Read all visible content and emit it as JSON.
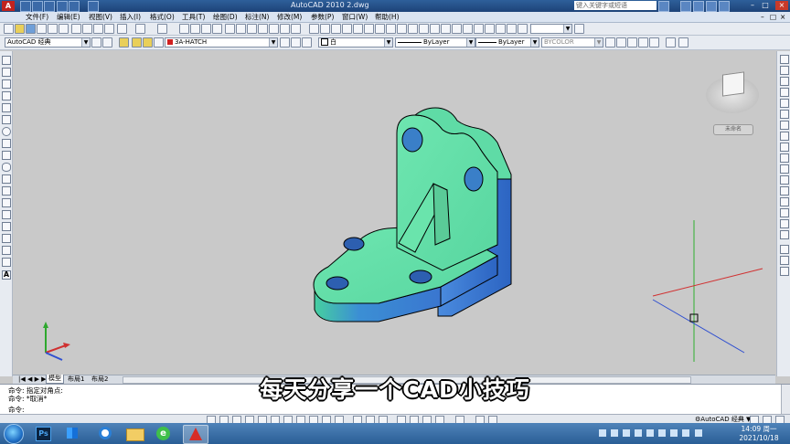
{
  "window": {
    "app_logo": "A",
    "title": "AutoCAD 2010    2.dwg",
    "search_placeholder": "键入关键字或短语",
    "min_label": "–",
    "max_label": "□",
    "close_label": "×"
  },
  "menu": [
    "文件(F)",
    "编辑(E)",
    "视图(V)",
    "插入(I)",
    "格式(O)",
    "工具(T)",
    "绘图(D)",
    "标注(N)",
    "修改(M)",
    "参数(P)",
    "窗口(W)",
    "帮助(H)"
  ],
  "properties_bar": {
    "workspace": "AutoCAD 经典",
    "layer": "3A-HATCH",
    "color": "白",
    "linetype": "ByLayer",
    "lineweight": "ByLayer",
    "plotstyle": "BYCOLOR"
  },
  "viewcube": {
    "label": "未命名"
  },
  "layout_tabs": [
    "模型",
    "布局1",
    "布局2"
  ],
  "command_lines": [
    "命令: 指定对角点:",
    "命令: *取消*",
    "命令:"
  ],
  "status_bar": {
    "workspace": "AutoCAD 经典"
  },
  "taskbar": {
    "time": "14:09 周一",
    "date": "2021/10/18",
    "ps_label": "Ps"
  },
  "subtitle": "每天分享一个CAD小技巧",
  "colors": {
    "model_top": "#66e0a8",
    "model_side": "#3a78d6",
    "drawing_bg": "#c9c9c9"
  }
}
